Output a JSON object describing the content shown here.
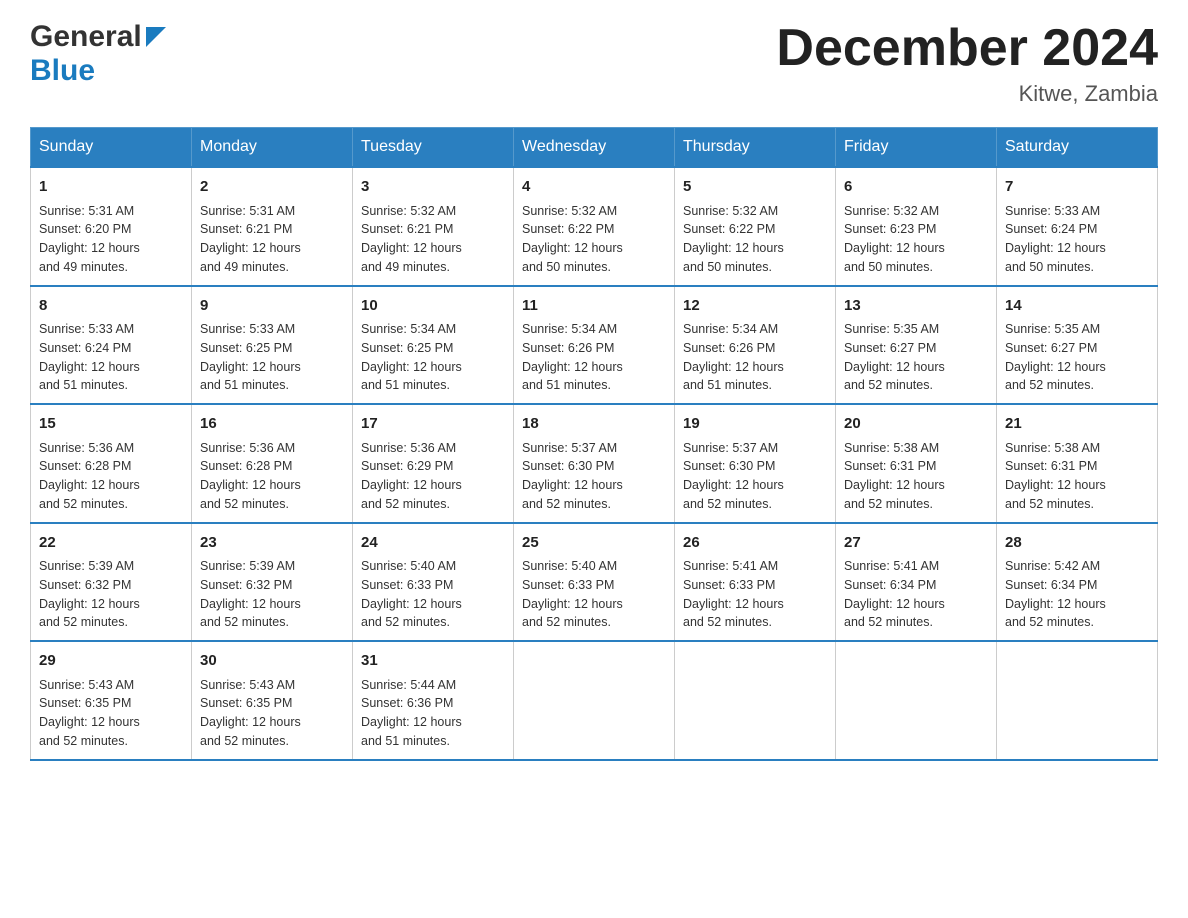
{
  "header": {
    "logo_general": "General",
    "logo_blue": "Blue",
    "month_title": "December 2024",
    "location": "Kitwe, Zambia"
  },
  "days_of_week": [
    "Sunday",
    "Monday",
    "Tuesday",
    "Wednesday",
    "Thursday",
    "Friday",
    "Saturday"
  ],
  "weeks": [
    [
      {
        "day": "1",
        "sunrise": "5:31 AM",
        "sunset": "6:20 PM",
        "daylight": "12 hours and 49 minutes."
      },
      {
        "day": "2",
        "sunrise": "5:31 AM",
        "sunset": "6:21 PM",
        "daylight": "12 hours and 49 minutes."
      },
      {
        "day": "3",
        "sunrise": "5:32 AM",
        "sunset": "6:21 PM",
        "daylight": "12 hours and 49 minutes."
      },
      {
        "day": "4",
        "sunrise": "5:32 AM",
        "sunset": "6:22 PM",
        "daylight": "12 hours and 50 minutes."
      },
      {
        "day": "5",
        "sunrise": "5:32 AM",
        "sunset": "6:22 PM",
        "daylight": "12 hours and 50 minutes."
      },
      {
        "day": "6",
        "sunrise": "5:32 AM",
        "sunset": "6:23 PM",
        "daylight": "12 hours and 50 minutes."
      },
      {
        "day": "7",
        "sunrise": "5:33 AM",
        "sunset": "6:24 PM",
        "daylight": "12 hours and 50 minutes."
      }
    ],
    [
      {
        "day": "8",
        "sunrise": "5:33 AM",
        "sunset": "6:24 PM",
        "daylight": "12 hours and 51 minutes."
      },
      {
        "day": "9",
        "sunrise": "5:33 AM",
        "sunset": "6:25 PM",
        "daylight": "12 hours and 51 minutes."
      },
      {
        "day": "10",
        "sunrise": "5:34 AM",
        "sunset": "6:25 PM",
        "daylight": "12 hours and 51 minutes."
      },
      {
        "day": "11",
        "sunrise": "5:34 AM",
        "sunset": "6:26 PM",
        "daylight": "12 hours and 51 minutes."
      },
      {
        "day": "12",
        "sunrise": "5:34 AM",
        "sunset": "6:26 PM",
        "daylight": "12 hours and 51 minutes."
      },
      {
        "day": "13",
        "sunrise": "5:35 AM",
        "sunset": "6:27 PM",
        "daylight": "12 hours and 52 minutes."
      },
      {
        "day": "14",
        "sunrise": "5:35 AM",
        "sunset": "6:27 PM",
        "daylight": "12 hours and 52 minutes."
      }
    ],
    [
      {
        "day": "15",
        "sunrise": "5:36 AM",
        "sunset": "6:28 PM",
        "daylight": "12 hours and 52 minutes."
      },
      {
        "day": "16",
        "sunrise": "5:36 AM",
        "sunset": "6:28 PM",
        "daylight": "12 hours and 52 minutes."
      },
      {
        "day": "17",
        "sunrise": "5:36 AM",
        "sunset": "6:29 PM",
        "daylight": "12 hours and 52 minutes."
      },
      {
        "day": "18",
        "sunrise": "5:37 AM",
        "sunset": "6:30 PM",
        "daylight": "12 hours and 52 minutes."
      },
      {
        "day": "19",
        "sunrise": "5:37 AM",
        "sunset": "6:30 PM",
        "daylight": "12 hours and 52 minutes."
      },
      {
        "day": "20",
        "sunrise": "5:38 AM",
        "sunset": "6:31 PM",
        "daylight": "12 hours and 52 minutes."
      },
      {
        "day": "21",
        "sunrise": "5:38 AM",
        "sunset": "6:31 PM",
        "daylight": "12 hours and 52 minutes."
      }
    ],
    [
      {
        "day": "22",
        "sunrise": "5:39 AM",
        "sunset": "6:32 PM",
        "daylight": "12 hours and 52 minutes."
      },
      {
        "day": "23",
        "sunrise": "5:39 AM",
        "sunset": "6:32 PM",
        "daylight": "12 hours and 52 minutes."
      },
      {
        "day": "24",
        "sunrise": "5:40 AM",
        "sunset": "6:33 PM",
        "daylight": "12 hours and 52 minutes."
      },
      {
        "day": "25",
        "sunrise": "5:40 AM",
        "sunset": "6:33 PM",
        "daylight": "12 hours and 52 minutes."
      },
      {
        "day": "26",
        "sunrise": "5:41 AM",
        "sunset": "6:33 PM",
        "daylight": "12 hours and 52 minutes."
      },
      {
        "day": "27",
        "sunrise": "5:41 AM",
        "sunset": "6:34 PM",
        "daylight": "12 hours and 52 minutes."
      },
      {
        "day": "28",
        "sunrise": "5:42 AM",
        "sunset": "6:34 PM",
        "daylight": "12 hours and 52 minutes."
      }
    ],
    [
      {
        "day": "29",
        "sunrise": "5:43 AM",
        "sunset": "6:35 PM",
        "daylight": "12 hours and 52 minutes."
      },
      {
        "day": "30",
        "sunrise": "5:43 AM",
        "sunset": "6:35 PM",
        "daylight": "12 hours and 52 minutes."
      },
      {
        "day": "31",
        "sunrise": "5:44 AM",
        "sunset": "6:36 PM",
        "daylight": "12 hours and 51 minutes."
      },
      null,
      null,
      null,
      null
    ]
  ],
  "labels": {
    "sunrise": "Sunrise:",
    "sunset": "Sunset:",
    "daylight": "Daylight:"
  }
}
